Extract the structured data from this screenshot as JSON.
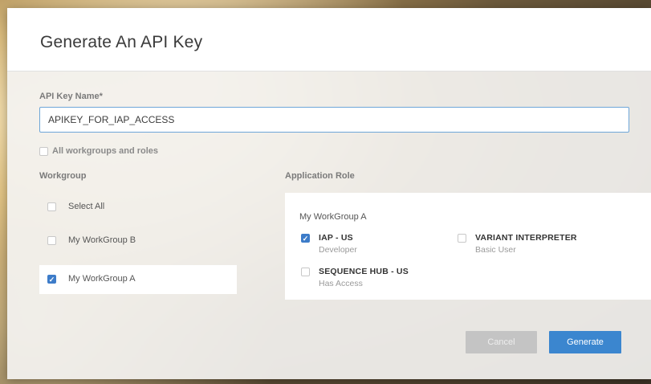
{
  "modal": {
    "title": "Generate An API Key"
  },
  "form": {
    "api_key_label": "API Key Name*",
    "api_key_value": "APIKEY_FOR_IAP_ACCESS",
    "all_workgroups_label": "All workgroups and roles",
    "all_workgroups_checked": false
  },
  "workgroups": {
    "label": "Workgroup",
    "items": [
      {
        "label": "Select All",
        "checked": false,
        "selected": false
      },
      {
        "label": "My WorkGroup B",
        "checked": false,
        "selected": false
      },
      {
        "label": "My WorkGroup A",
        "checked": true,
        "selected": true
      }
    ]
  },
  "roles": {
    "label": "Application Role",
    "group_title": "My WorkGroup A",
    "items": [
      {
        "name": "IAP - US",
        "role": "Developer",
        "checked": true
      },
      {
        "name": "VARIANT INTERPRETER",
        "role": "Basic User",
        "checked": false
      },
      {
        "name": "SEQUENCE HUB - US",
        "role": "Has Access",
        "checked": false
      }
    ]
  },
  "buttons": {
    "cancel_label": "Cancel",
    "generate_label": "Generate"
  },
  "colors": {
    "accent": "#3b86cf",
    "checkbox_checked": "#3d7cc9",
    "input_focus_border": "#6ea6d8"
  }
}
